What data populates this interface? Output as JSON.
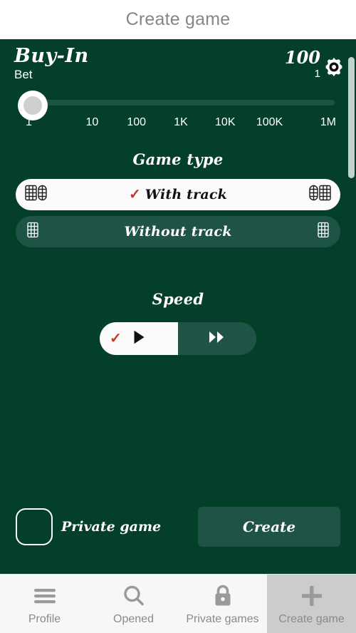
{
  "header": {
    "title": "Create game"
  },
  "buyin": {
    "title": "Buy-In",
    "bet_label": "Bet",
    "amount": "100",
    "sub_amount": "1",
    "settings_icon": "gear-icon"
  },
  "slider": {
    "value": "1",
    "ticks": [
      "1",
      "10",
      "100",
      "1K",
      "10K",
      "100K",
      "1M"
    ]
  },
  "game_type": {
    "title": "Game type",
    "options": [
      {
        "label": "With track",
        "selected": true,
        "check": "✓",
        "icon": "track-board-double-icon"
      },
      {
        "label": "Without track",
        "selected": false,
        "check": "",
        "icon": "track-board-single-icon"
      }
    ]
  },
  "speed": {
    "title": "Speed",
    "options": [
      {
        "icon": "play-icon",
        "selected": true,
        "check": "✓"
      },
      {
        "icon": "fast-forward-icon",
        "selected": false,
        "check": ""
      }
    ]
  },
  "footer": {
    "private_label": "Private game",
    "private_checked": false,
    "create_label": "Create"
  },
  "bottom_nav": [
    {
      "label": "Profile",
      "icon": "hamburger-menu-icon",
      "active": false
    },
    {
      "label": "Opened",
      "icon": "search-icon",
      "active": false
    },
    {
      "label": "Private games",
      "icon": "lock-icon",
      "active": false
    },
    {
      "label": "Create game",
      "icon": "plus-icon",
      "active": true
    }
  ],
  "colors": {
    "background": "#044029",
    "panel": "#1f5345",
    "accent_check": "#c0392b",
    "selected_bg": "#fbfbfb",
    "nav_bg": "#f7f7f7",
    "nav_active_bg": "#cccccc",
    "muted_text": "#868686"
  }
}
